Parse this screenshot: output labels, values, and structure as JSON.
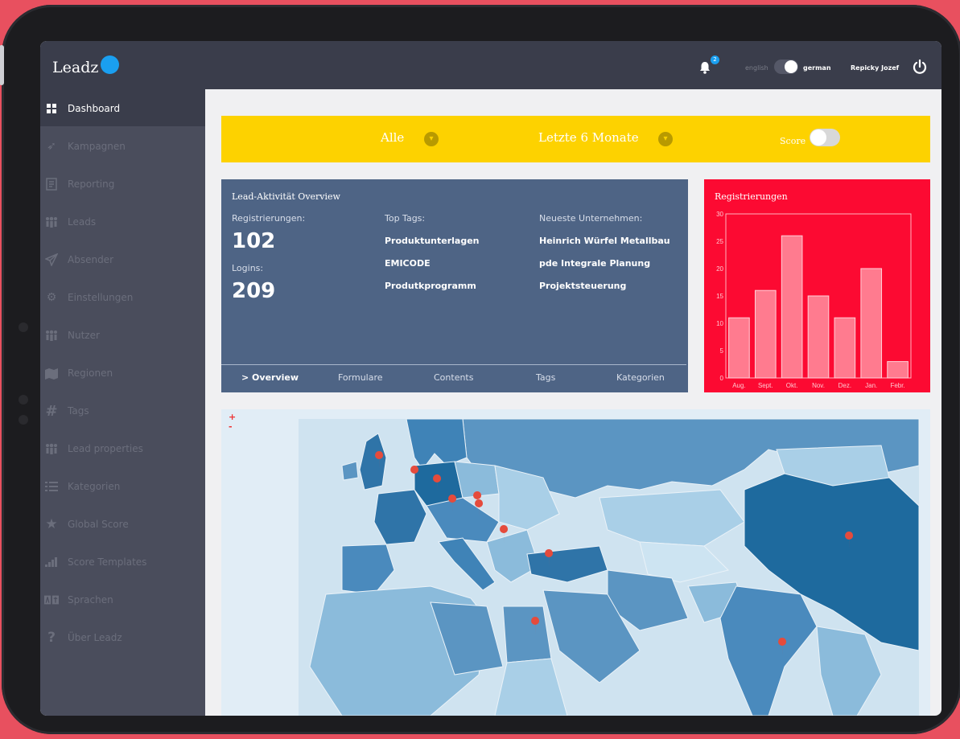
{
  "app": {
    "name": "Leadz"
  },
  "header": {
    "notifications_count": "2",
    "lang_english": "english",
    "lang_german": "german",
    "user_name": "Repicky Jozef"
  },
  "sidebar": {
    "items": [
      {
        "label": "Dashboard",
        "icon": "dashboard-icon",
        "active": true
      },
      {
        "label": "Kampagnen",
        "icon": "rocket-icon"
      },
      {
        "label": "Reporting",
        "icon": "report-icon"
      },
      {
        "label": "Leads",
        "icon": "users-icon"
      },
      {
        "label": "Absender",
        "icon": "send-icon"
      },
      {
        "label": "Einstellungen",
        "icon": "gear-icon"
      },
      {
        "label": "Nutzer",
        "icon": "users-icon"
      },
      {
        "label": "Regionen",
        "icon": "map-icon"
      },
      {
        "label": "Tags",
        "icon": "hash-icon"
      },
      {
        "label": "Lead properties",
        "icon": "users-icon"
      },
      {
        "label": "Kategorien",
        "icon": "list-icon"
      },
      {
        "label": "Global Score",
        "icon": "star-icon"
      },
      {
        "label": "Score Templates",
        "icon": "signal-icon"
      },
      {
        "label": "Sprachen",
        "icon": "translate-icon"
      },
      {
        "label": "Über Leadz",
        "icon": "question-icon"
      }
    ]
  },
  "filters": {
    "segment": "Alle",
    "period": "Letzte 6 Monate",
    "score_label": "Score"
  },
  "overview": {
    "title": "Lead-Aktivität Overview",
    "registrations_label": "Registrierungen:",
    "registrations_value": "102",
    "logins_label": "Logins:",
    "logins_value": "209",
    "top_tags_label": "Top Tags:",
    "top_tags": [
      "Produktunterlagen",
      "EMICODE",
      "Produtkprogramm"
    ],
    "companies_label": "Neueste Unternehmen:",
    "companies": [
      "Heinrich Würfel Metallbau",
      "pde Integrale Planung",
      "Projektsteuerung"
    ],
    "tabs": [
      "> Overview",
      "Formulare",
      "Contents",
      "Tags",
      "Kategorien"
    ]
  },
  "map": {
    "zoom_in": "+",
    "zoom_out": "-"
  },
  "chart_data": {
    "type": "bar",
    "title": "Registrierungen",
    "categories": [
      "Aug.",
      "Sept.",
      "Okt.",
      "Nov.",
      "Dez.",
      "Jan.",
      "Febr."
    ],
    "values": [
      11,
      16,
      26,
      15,
      11,
      20,
      3
    ],
    "ylim": [
      0,
      30
    ],
    "yticks": [
      0,
      5,
      10,
      15,
      20,
      25,
      30
    ],
    "xlabel": "",
    "ylabel": "",
    "grid": false,
    "colors": {
      "background": "#fc0a32",
      "bar": "#ff7b8f"
    }
  }
}
